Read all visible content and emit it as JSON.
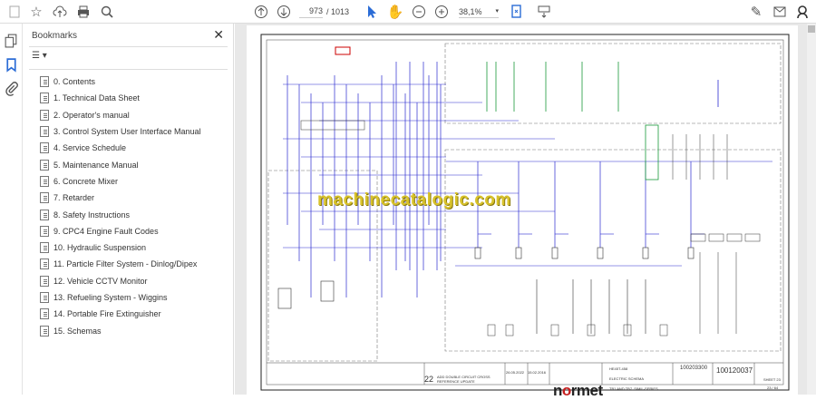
{
  "toolbar": {
    "page_current": "973",
    "page_total": "/ 1013",
    "zoom": "38,1%"
  },
  "bookmarks": {
    "title": "Bookmarks",
    "items": [
      {
        "label": "0. Contents"
      },
      {
        "label": "1. Technical Data Sheet"
      },
      {
        "label": "2. Operator's manual"
      },
      {
        "label": "3. Control System User Interface Manual"
      },
      {
        "label": "4. Service Schedule"
      },
      {
        "label": "5. Maintenance Manual"
      },
      {
        "label": "6. Concrete Mixer"
      },
      {
        "label": "7. Retarder"
      },
      {
        "label": "8. Safety Instructions"
      },
      {
        "label": "9. CPC4 Engine Fault Codes"
      },
      {
        "label": "10. Hydraulic Suspension"
      },
      {
        "label": "11. Particle Filter System - Dinlog/Dipex"
      },
      {
        "label": "12. Vehicle CCTV Monitor"
      },
      {
        "label": "13. Refueling System - Wiggins"
      },
      {
        "label": "14. Portable Fire Extinguisher"
      },
      {
        "label": "15. Schemas"
      }
    ]
  },
  "document": {
    "watermark": "machinecatalogic.com",
    "logo": "normet",
    "title_block": {
      "rev": "22",
      "change": "ADD DOUBLE CIRCUIT CROSS REFERENCE UPDATE",
      "rev_date": "26.05.2022",
      "date": "15.02.2016",
      "code": "HE45T-458",
      "title": "ELECTRIC SCHEMA",
      "subtitle": "TB1 AND TB7, SIMIL-SERIES",
      "doc_no": "100203300",
      "drawing_no": "100120037",
      "sheet": "SHEET 23",
      "page_of": "23 / 64"
    }
  },
  "colors": {
    "wire": "#2a2ad0",
    "green": "#1a9a3a",
    "accent": "#2b6cd6"
  }
}
